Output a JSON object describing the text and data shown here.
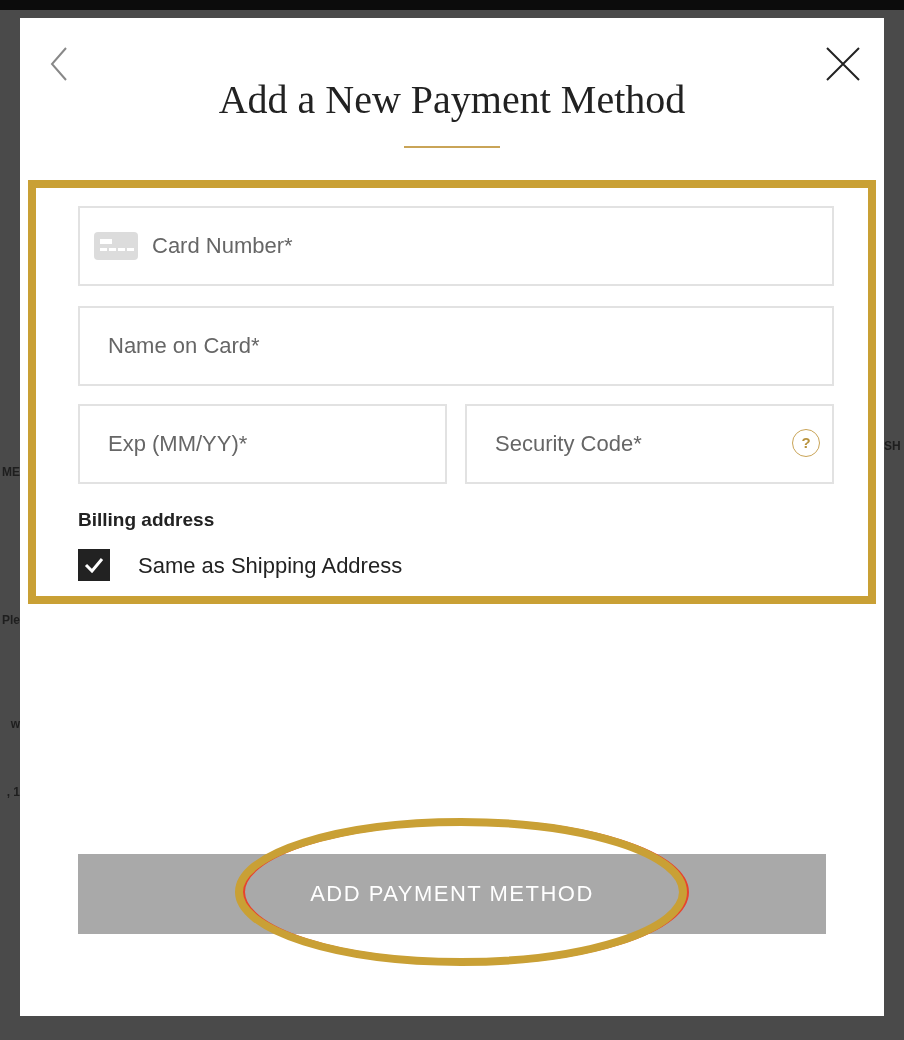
{
  "background": {
    "left_fragments": [
      "ME",
      "Ple",
      "w",
      ", 1"
    ],
    "right_fragments": [
      "SH"
    ]
  },
  "modal": {
    "title": "Add a New Payment Method",
    "fields": [
      {
        "kind": "card",
        "placeholder": "Card Number*"
      },
      {
        "kind": "plain",
        "placeholder": "Name on Card*"
      },
      {
        "kind": "plain",
        "placeholder": "Exp (MM/YY)*"
      },
      {
        "kind": "help",
        "placeholder": "Security Code*",
        "help": "?"
      }
    ],
    "billing_label": "Billing address",
    "same_as_shipping": {
      "label": "Same as Shipping Address",
      "checked": true
    },
    "submit": {
      "label": "ADD PAYMENT METHOD",
      "disabled": true
    }
  }
}
